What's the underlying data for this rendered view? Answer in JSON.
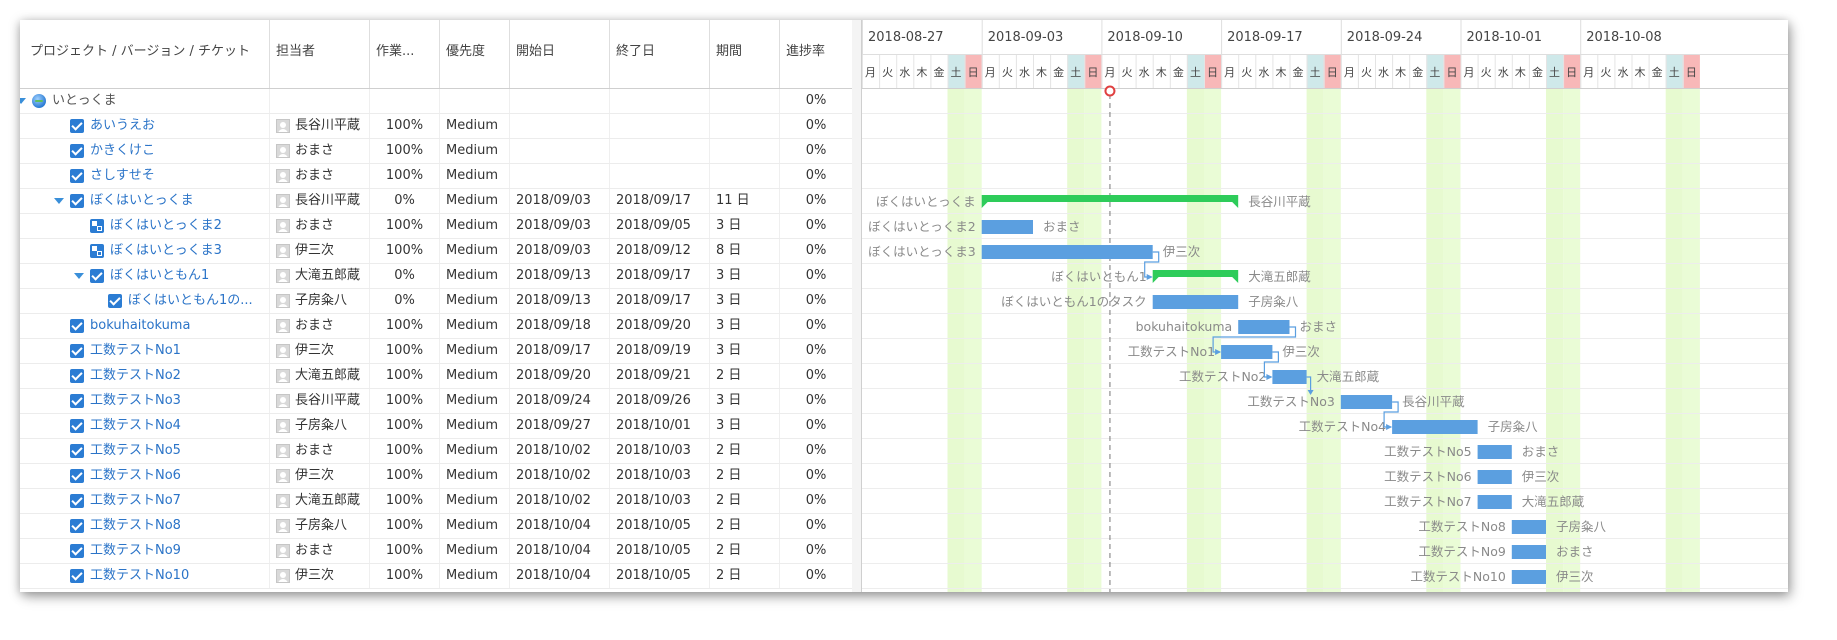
{
  "columns": {
    "name": "プロジェクト / バージョン / チケット",
    "assignee": "担当者",
    "work": "作業...",
    "priority": "優先度",
    "start": "開始日",
    "end": "終了日",
    "duration": "期間",
    "progress": "進捗率"
  },
  "weeks": [
    "2018-08-27",
    "2018-09-03",
    "2018-09-10",
    "2018-09-17",
    "2018-09-24",
    "2018-10-01",
    "2018-10-08"
  ],
  "weekdays": [
    "月",
    "火",
    "水",
    "木",
    "金",
    "土",
    "日"
  ],
  "today_index": 14,
  "colors": {
    "link": "#2b74c8",
    "bar": "#5b9fe0",
    "summary_bar": "#2ecc5a",
    "saturday_bg": "#e7fad0",
    "sunday_bg": "#f8b8b8",
    "today_marker": "#e04040"
  },
  "rows": [
    {
      "level": 0,
      "type": "project",
      "icon": "globe-icon",
      "expand": true,
      "name": "いとっくま",
      "assignee": "",
      "work": "",
      "priority": "",
      "start": "",
      "end": "",
      "duration": "",
      "progress": "0%"
    },
    {
      "level": 1,
      "type": "task",
      "icon": "checkbox-icon",
      "expand": false,
      "name": "あいうえお",
      "assignee": "長谷川平蔵",
      "work": "100%",
      "priority": "Medium",
      "start": "",
      "end": "",
      "duration": "",
      "progress": "0%"
    },
    {
      "level": 1,
      "type": "task",
      "icon": "checkbox-icon",
      "expand": false,
      "name": "かきくけこ",
      "assignee": "おまさ",
      "work": "100%",
      "priority": "Medium",
      "start": "",
      "end": "",
      "duration": "",
      "progress": "0%"
    },
    {
      "level": 1,
      "type": "task",
      "icon": "checkbox-icon",
      "expand": false,
      "name": "さしすせそ",
      "assignee": "おまさ",
      "work": "100%",
      "priority": "Medium",
      "start": "",
      "end": "",
      "duration": "",
      "progress": "0%"
    },
    {
      "level": 1,
      "type": "parent",
      "icon": "checkbox-icon",
      "expand": true,
      "name": "ぼくはいとっくま",
      "assignee": "長谷川平蔵",
      "work": "0%",
      "priority": "Medium",
      "start": "2018/09/03",
      "end": "2018/09/17",
      "duration": "11 日",
      "progress": "0%",
      "bar": {
        "kind": "summary",
        "s": 7,
        "e": 22,
        "left": "ぼくはいとっくま",
        "right": "長谷川平蔵"
      }
    },
    {
      "level": 2,
      "type": "subtask",
      "icon": "subtask-icon",
      "expand": false,
      "name": "ぼくはいとっくま2",
      "assignee": "おまさ",
      "work": "100%",
      "priority": "Medium",
      "start": "2018/09/03",
      "end": "2018/09/05",
      "duration": "3 日",
      "progress": "0%",
      "bar": {
        "kind": "task",
        "s": 7,
        "e": 10,
        "left": "ぼくはいとっくま2",
        "right": "おまさ"
      }
    },
    {
      "level": 2,
      "type": "subtask",
      "icon": "subtask-icon",
      "expand": false,
      "name": "ぼくはいとっくま3",
      "assignee": "伊三次",
      "work": "100%",
      "priority": "Medium",
      "start": "2018/09/03",
      "end": "2018/09/12",
      "duration": "8 日",
      "progress": "0%",
      "bar": {
        "kind": "task",
        "s": 7,
        "e": 17,
        "left": "ぼくはいとっくま3",
        "right": "伊三次"
      }
    },
    {
      "level": 2,
      "type": "parent",
      "icon": "checkbox-icon",
      "expand": true,
      "name": "ぼくはいともん1",
      "assignee": "大滝五郎蔵",
      "work": "0%",
      "priority": "Medium",
      "start": "2018/09/13",
      "end": "2018/09/17",
      "duration": "3 日",
      "progress": "0%",
      "bar": {
        "kind": "summary",
        "s": 17,
        "e": 22,
        "left": "ぼくはいともん1",
        "right": "大滝五郎蔵"
      }
    },
    {
      "level": 3,
      "type": "task",
      "icon": "checkbox-icon",
      "expand": false,
      "name": "ぼくはいともん1の...",
      "assignee": "子房粂八",
      "work": "0%",
      "priority": "Medium",
      "start": "2018/09/13",
      "end": "2018/09/17",
      "duration": "3 日",
      "progress": "0%",
      "bar": {
        "kind": "task",
        "s": 17,
        "e": 22,
        "left": "ぼくはいともん1のタスク",
        "right": "子房粂八"
      }
    },
    {
      "level": 1,
      "type": "task",
      "icon": "checkbox-icon",
      "expand": false,
      "name": "bokuhaitokuma",
      "assignee": "おまさ",
      "work": "100%",
      "priority": "Medium",
      "start": "2018/09/18",
      "end": "2018/09/20",
      "duration": "3 日",
      "progress": "0%",
      "bar": {
        "kind": "task",
        "s": 22,
        "e": 25,
        "left": "bokuhaitokuma",
        "right": "おまさ"
      }
    },
    {
      "level": 1,
      "type": "task",
      "icon": "checkbox-icon",
      "expand": false,
      "name": "工数テストNo1",
      "assignee": "伊三次",
      "work": "100%",
      "priority": "Medium",
      "start": "2018/09/17",
      "end": "2018/09/19",
      "duration": "3 日",
      "progress": "0%",
      "bar": {
        "kind": "task",
        "s": 21,
        "e": 24,
        "left": "工数テストNo1",
        "right": "伊三次"
      }
    },
    {
      "level": 1,
      "type": "task",
      "icon": "checkbox-icon",
      "expand": false,
      "name": "工数テストNo2",
      "assignee": "大滝五郎蔵",
      "work": "100%",
      "priority": "Medium",
      "start": "2018/09/20",
      "end": "2018/09/21",
      "duration": "2 日",
      "progress": "0%",
      "bar": {
        "kind": "task",
        "s": 24,
        "e": 26,
        "left": "工数テストNo2",
        "right": "大滝五郎蔵"
      }
    },
    {
      "level": 1,
      "type": "task",
      "icon": "checkbox-icon",
      "expand": false,
      "name": "工数テストNo3",
      "assignee": "長谷川平蔵",
      "work": "100%",
      "priority": "Medium",
      "start": "2018/09/24",
      "end": "2018/09/26",
      "duration": "3 日",
      "progress": "0%",
      "bar": {
        "kind": "task",
        "s": 28,
        "e": 31,
        "left": "工数テストNo3",
        "right": "長谷川平蔵"
      }
    },
    {
      "level": 1,
      "type": "task",
      "icon": "checkbox-icon",
      "expand": false,
      "name": "工数テストNo4",
      "assignee": "子房粂八",
      "work": "100%",
      "priority": "Medium",
      "start": "2018/09/27",
      "end": "2018/10/01",
      "duration": "3 日",
      "progress": "0%",
      "bar": {
        "kind": "task",
        "s": 31,
        "e": 36,
        "left": "工数テストNo4",
        "right": "子房粂八"
      }
    },
    {
      "level": 1,
      "type": "task",
      "icon": "checkbox-icon",
      "expand": false,
      "name": "工数テストNo5",
      "assignee": "おまさ",
      "work": "100%",
      "priority": "Medium",
      "start": "2018/10/02",
      "end": "2018/10/03",
      "duration": "2 日",
      "progress": "0%",
      "bar": {
        "kind": "task",
        "s": 36,
        "e": 38,
        "left": "工数テストNo5",
        "right": "おまさ"
      }
    },
    {
      "level": 1,
      "type": "task",
      "icon": "checkbox-icon",
      "expand": false,
      "name": "工数テストNo6",
      "assignee": "伊三次",
      "work": "100%",
      "priority": "Medium",
      "start": "2018/10/02",
      "end": "2018/10/03",
      "duration": "2 日",
      "progress": "0%",
      "bar": {
        "kind": "task",
        "s": 36,
        "e": 38,
        "left": "工数テストNo6",
        "right": "伊三次"
      }
    },
    {
      "level": 1,
      "type": "task",
      "icon": "checkbox-icon",
      "expand": false,
      "name": "工数テストNo7",
      "assignee": "大滝五郎蔵",
      "work": "100%",
      "priority": "Medium",
      "start": "2018/10/02",
      "end": "2018/10/03",
      "duration": "2 日",
      "progress": "0%",
      "bar": {
        "kind": "task",
        "s": 36,
        "e": 38,
        "left": "工数テストNo7",
        "right": "大滝五郎蔵"
      }
    },
    {
      "level": 1,
      "type": "task",
      "icon": "checkbox-icon",
      "expand": false,
      "name": "工数テストNo8",
      "assignee": "子房粂八",
      "work": "100%",
      "priority": "Medium",
      "start": "2018/10/04",
      "end": "2018/10/05",
      "duration": "2 日",
      "progress": "0%",
      "bar": {
        "kind": "task",
        "s": 38,
        "e": 40,
        "left": "工数テストNo8",
        "right": "子房粂八"
      }
    },
    {
      "level": 1,
      "type": "task",
      "icon": "checkbox-icon",
      "expand": false,
      "name": "工数テストNo9",
      "assignee": "おまさ",
      "work": "100%",
      "priority": "Medium",
      "start": "2018/10/04",
      "end": "2018/10/05",
      "duration": "2 日",
      "progress": "0%",
      "bar": {
        "kind": "task",
        "s": 38,
        "e": 40,
        "left": "工数テストNo9",
        "right": "おまさ"
      }
    },
    {
      "level": 1,
      "type": "task",
      "icon": "checkbox-icon",
      "expand": false,
      "name": "工数テストNo10",
      "assignee": "伊三次",
      "work": "100%",
      "priority": "Medium",
      "start": "2018/10/04",
      "end": "2018/10/05",
      "duration": "2 日",
      "progress": "0%",
      "bar": {
        "kind": "task",
        "s": 38,
        "e": 40,
        "left": "工数テストNo10",
        "right": "伊三次"
      }
    }
  ],
  "dependencies": [
    [
      6,
      7
    ],
    [
      9,
      10
    ],
    [
      10,
      11
    ],
    [
      11,
      12
    ],
    [
      12,
      13
    ]
  ]
}
